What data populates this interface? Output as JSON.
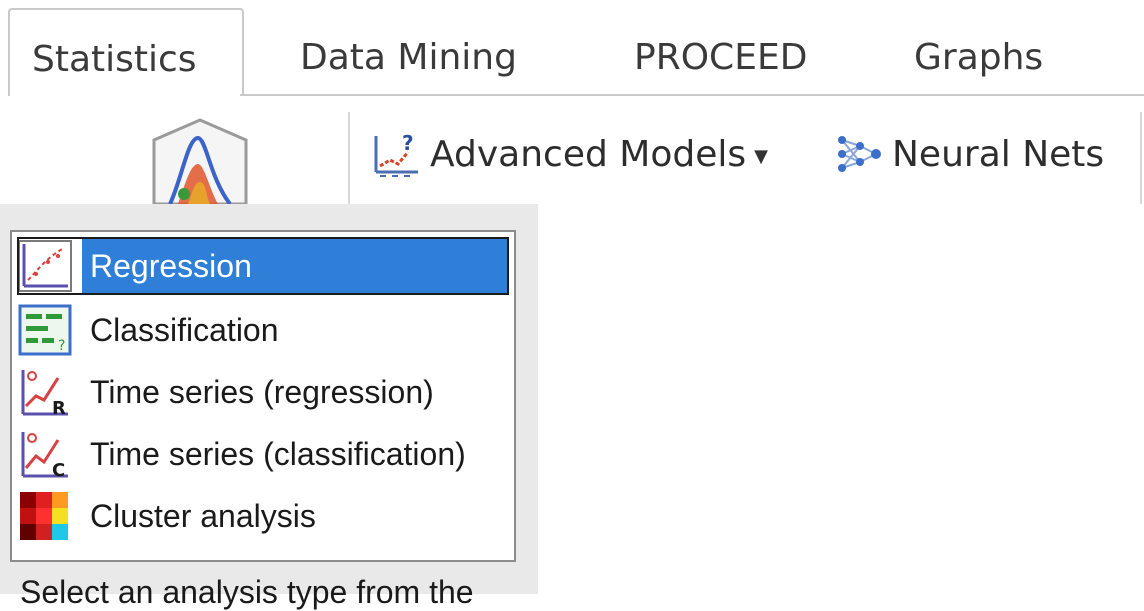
{
  "tabs": [
    {
      "label": "Statistics"
    },
    {
      "label": "Data Mining"
    },
    {
      "label": "PROCEED"
    },
    {
      "label": "Graphs"
    }
  ],
  "ribbon": {
    "advanced_models_label": "Advanced Models",
    "neural_nets_label": "Neural Nets"
  },
  "analysis_list": {
    "items": [
      {
        "label": "Regression",
        "icon": "regression-icon"
      },
      {
        "label": "Classification",
        "icon": "classification-icon"
      },
      {
        "label": "Time series (regression)",
        "icon": "time-series-regression-icon"
      },
      {
        "label": "Time series (classification)",
        "icon": "time-series-classification-icon"
      },
      {
        "label": "Cluster analysis",
        "icon": "cluster-analysis-icon"
      }
    ],
    "selected_index": 0
  },
  "hint_text": "Select an analysis type from the",
  "colors": {
    "selection": "#2f7fd8",
    "panel_bg": "#e9e9e9"
  }
}
